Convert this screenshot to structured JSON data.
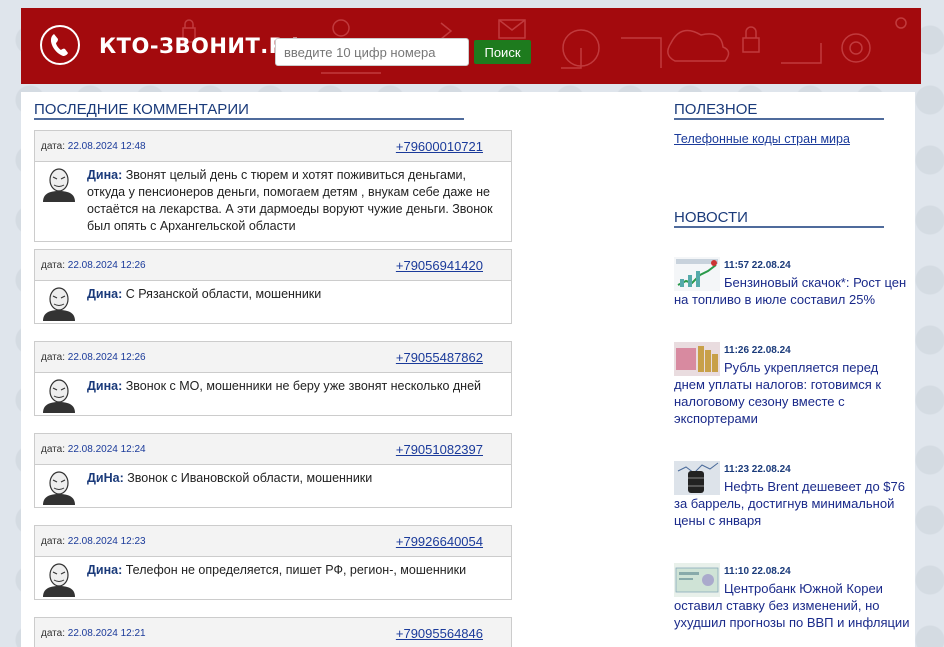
{
  "header": {
    "logo_text": "КТО-ЗВОНИТ.РФ",
    "search_placeholder": "введите 10 цифр номера",
    "search_button": "Поиск",
    "bg_color": "#a30a0d"
  },
  "comments_section": {
    "title": "ПОСЛЕДНИЕ КОММЕНТАРИИ",
    "date_label": "дата:",
    "items": [
      {
        "date": "22.08.2024 12:48",
        "phone": "+79600010721",
        "author": "Дина:",
        "text": "Звонят целый день с тюрем и хотят поживиться деньгами, откуда у пенсионеров деньги, помогаем детям , внукам себе даже не остаётся на лекарства. А эти дармоеды воруют чужие деньги. Звонок был опять с Архангельской области"
      },
      {
        "date": "22.08.2024 12:26",
        "phone": "+79056941420",
        "author": "Дина:",
        "text": "С Рязанской области, мошенники"
      },
      {
        "date": "22.08.2024 12:26",
        "phone": "+79055487862",
        "author": "Дина:",
        "text": "Звонок с МО, мошенники не беру уже звонят несколько дней"
      },
      {
        "date": "22.08.2024 12:24",
        "phone": "+79051082397",
        "author": "ДиНа:",
        "text": "Звонок с Ивановской области, мошенники"
      },
      {
        "date": "22.08.2024 12:23",
        "phone": "+79926640054",
        "author": "Дина:",
        "text": "Телефон не определяется, пишет РФ, регион-, мошенники"
      },
      {
        "date": "22.08.2024 12:21",
        "phone": "+79095564846",
        "author": "",
        "text": ""
      }
    ]
  },
  "useful_section": {
    "title": "ПОЛЕЗНОЕ",
    "links": [
      "Телефонные коды стран мира"
    ]
  },
  "news_section": {
    "title": "НОВОСТИ",
    "items": [
      {
        "time": "11:57 22.08.24",
        "title": "Бензиновый скачок*: Рост цен на топливо в июле составил 25%"
      },
      {
        "time": "11:26 22.08.24",
        "title": "Рубль укрепляется перед днем уплаты налогов: готовимся к налоговому сезону вместе с экспортерами"
      },
      {
        "time": "11:23 22.08.24",
        "title": "Нефть Brent дешевеет до $76 за баррель, достигнув минимальной цены с января"
      },
      {
        "time": "11:10 22.08.24",
        "title": "Центробанк Южной Кореи оставил ставку без изменений, но ухудшил прогнозы по ВВП и инфляции"
      }
    ]
  }
}
